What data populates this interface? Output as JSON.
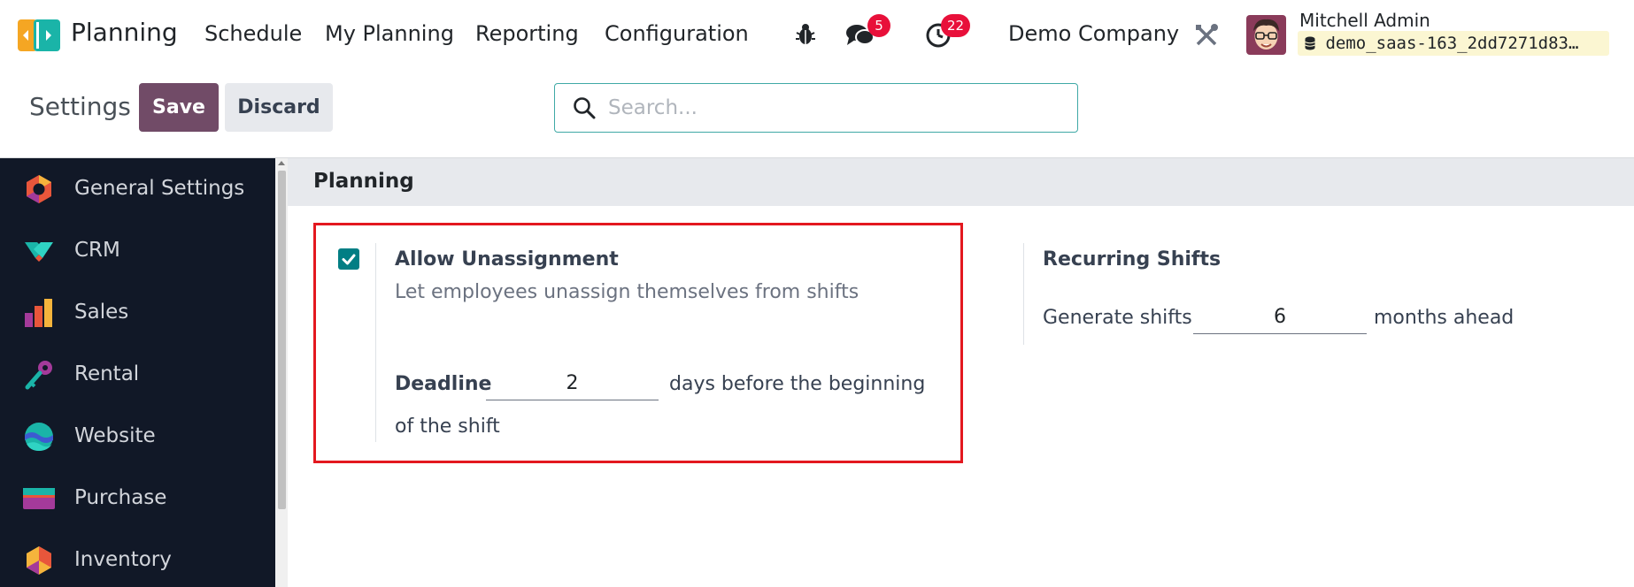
{
  "navbar": {
    "app_name": "Planning",
    "menus": [
      "Schedule",
      "My Planning",
      "Reporting",
      "Configuration"
    ],
    "messages_count": "5",
    "activities_count": "22",
    "company": "Demo Company",
    "user_name": "Mitchell Admin",
    "database": "demo_saas-163_2dd7271d83…",
    "icons": {
      "debug": "bug-icon",
      "messages": "chat-icon",
      "activities": "clock-icon",
      "settings": "tools-icon",
      "database": "database-icon"
    }
  },
  "control_panel": {
    "title": "Settings",
    "save_label": "Save",
    "discard_label": "Discard",
    "search_placeholder": "Search..."
  },
  "sidebar": {
    "items": [
      {
        "label": "General Settings",
        "icon": "general-settings-icon"
      },
      {
        "label": "CRM",
        "icon": "crm-icon"
      },
      {
        "label": "Sales",
        "icon": "sales-icon"
      },
      {
        "label": "Rental",
        "icon": "rental-icon"
      },
      {
        "label": "Website",
        "icon": "website-icon"
      },
      {
        "label": "Purchase",
        "icon": "purchase-icon"
      },
      {
        "label": "Inventory",
        "icon": "inventory-icon"
      }
    ]
  },
  "main": {
    "section_title": "Planning",
    "allow_unassignment": {
      "checked": true,
      "title": "Allow Unassignment",
      "description": "Let employees unassign themselves from shifts",
      "deadline_label": "Deadline",
      "deadline_value": "2",
      "deadline_suffix_line1": "days before the beginning",
      "deadline_suffix_line2": "of the shift"
    },
    "recurring_shifts": {
      "title": "Recurring Shifts",
      "generate_label": "Generate shifts",
      "generate_value": "6",
      "generate_suffix": "months ahead"
    }
  },
  "colors": {
    "brand": "#714b67",
    "sidebar_bg": "#111827",
    "checkbox": "#017e84",
    "badge": "#e8103a",
    "highlight": "#e3181f"
  }
}
